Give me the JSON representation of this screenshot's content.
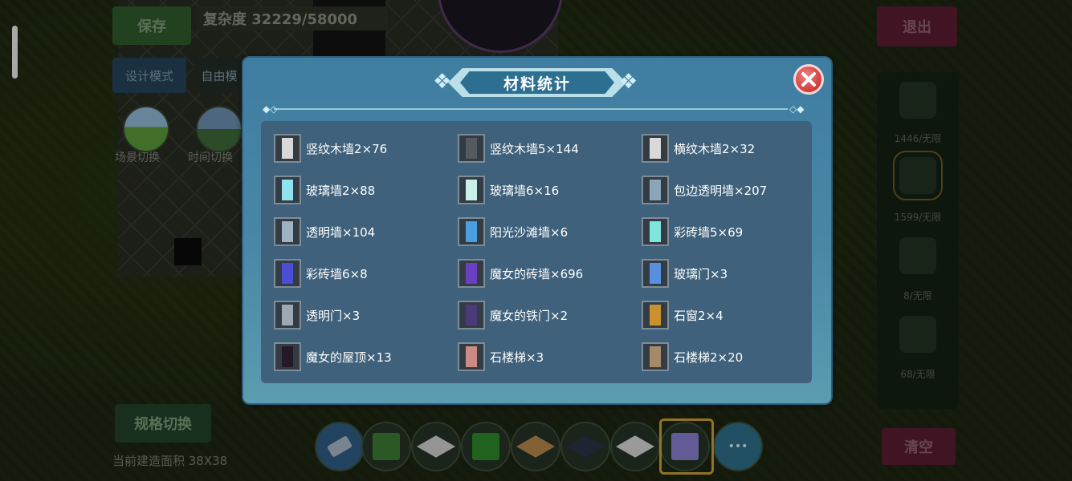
{
  "hud": {
    "save_label": "保存",
    "complexity": "复杂度 32229/58000",
    "design_mode_label": "设计模式",
    "free_label": "自由模",
    "scene_switch_label": "场景切换",
    "time_switch_label": "时间切换",
    "exit_label": "退出",
    "clear_label": "清空",
    "spec_switch_label": "规格切换",
    "build_area": "当前建造面积 38X38"
  },
  "right_panel": {
    "items": [
      {
        "icon": "brick-block-icon",
        "label": "1446/无限"
      },
      {
        "icon": "stone-wall-icon",
        "label": "1599/无限",
        "selected": true
      },
      {
        "icon": "window-block-icon",
        "label": "8/无限"
      },
      {
        "icon": "door-block-icon",
        "label": "68/无限"
      }
    ]
  },
  "hotbar": {
    "items": [
      {
        "name": "eraser-icon",
        "color": "#a9b8c6"
      },
      {
        "name": "grass-block-icon",
        "color": "#3e7b34"
      },
      {
        "name": "white-floor-tile-icon",
        "color": "#cfcfcf"
      },
      {
        "name": "green-block-icon",
        "color": "#2f8a2a"
      },
      {
        "name": "orange-floor-tile-icon",
        "color": "#b8864a"
      },
      {
        "name": "dark-floor-tile-icon",
        "color": "#2a3346"
      },
      {
        "name": "white-slab-icon",
        "color": "#d6d6d6"
      },
      {
        "name": "crystal-lattice-icon",
        "color": "#8a7fd0",
        "selected": true
      },
      {
        "name": "more-icon",
        "color": "#2f6e8a"
      }
    ]
  },
  "modal": {
    "title": "材料统计",
    "close_icon": "close-icon",
    "materials": [
      {
        "label": "竖纹木墙2×76",
        "icon": "vertical-wood-wall-icon",
        "color": "#d8d8d8"
      },
      {
        "label": "竖纹木墙5×144",
        "icon": "vertical-wood-wall-dark-icon",
        "color": "#555a5e"
      },
      {
        "label": "横纹木墙2×32",
        "icon": "horizontal-wood-wall-icon",
        "color": "#d9d9d9"
      },
      {
        "label": "玻璃墙2×88",
        "icon": "glass-wall-icon",
        "color": "#8fe3ee"
      },
      {
        "label": "玻璃墙6×16",
        "icon": "glass-wall-light-icon",
        "color": "#c9f1e9"
      },
      {
        "label": "包边透明墙×207",
        "icon": "edged-transparent-wall-icon",
        "color": "#8aa6b8"
      },
      {
        "label": "透明墙×104",
        "icon": "transparent-wall-icon",
        "color": "#9db3c1"
      },
      {
        "label": "阳光沙滩墙×6",
        "icon": "sunny-beach-wall-icon",
        "color": "#4a9ee0"
      },
      {
        "label": "彩砖墙5×69",
        "icon": "colored-brick-wall-cyan-icon",
        "color": "#7fe6dd"
      },
      {
        "label": "彩砖墙6×8",
        "icon": "colored-brick-wall-blue-icon",
        "color": "#4a4fd6"
      },
      {
        "label": "魔女的砖墙×696",
        "icon": "witch-brick-wall-icon",
        "color": "#6a3fc0"
      },
      {
        "label": "玻璃门×3",
        "icon": "glass-door-icon",
        "color": "#5a8fe0"
      },
      {
        "label": "透明门×3",
        "icon": "transparent-door-icon",
        "color": "#9aa9b3"
      },
      {
        "label": "魔女的铁门×2",
        "icon": "witch-iron-gate-icon",
        "color": "#4a3a7a"
      },
      {
        "label": "石窗2×4",
        "icon": "stone-window-icon",
        "color": "#c9922f"
      },
      {
        "label": "魔女的屋顶×13",
        "icon": "witch-roof-icon",
        "color": "#241a26"
      },
      {
        "label": "石楼梯×3",
        "icon": "stone-stairs-icon",
        "color": "#c98b84"
      },
      {
        "label": "石楼梯2×20",
        "icon": "stone-stairs-dark-icon",
        "color": "#a58a6a"
      }
    ]
  }
}
